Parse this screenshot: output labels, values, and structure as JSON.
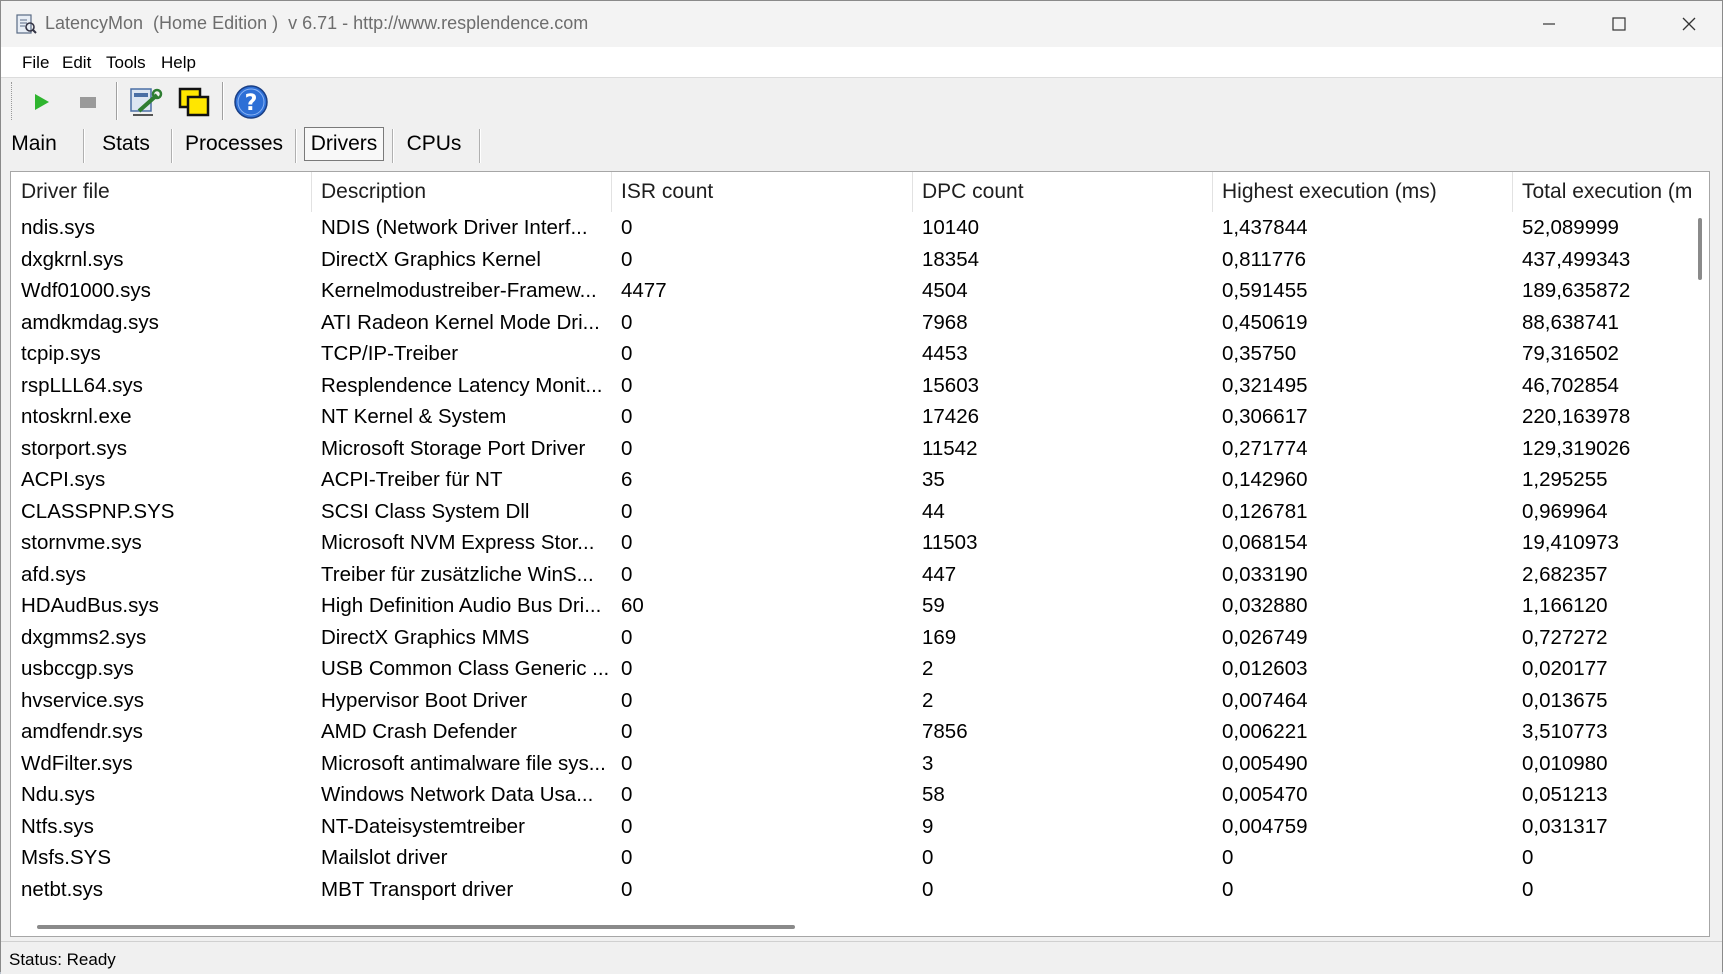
{
  "window": {
    "title": "LatencyMon  (Home Edition )  v 6.71 - http://www.resplendence.com"
  },
  "menu": {
    "file": "File",
    "edit": "Edit",
    "tools": "Tools",
    "help": "Help"
  },
  "toolbar": {
    "icons": [
      "play-icon",
      "stop-icon",
      "wrench-icon",
      "windows-icon",
      "help-icon"
    ]
  },
  "tabs": {
    "main": "Main",
    "stats": "Stats",
    "processes": "Processes",
    "drivers": "Drivers",
    "cpus": "CPUs",
    "active": "Drivers"
  },
  "table": {
    "columns": [
      "Driver file",
      "Description",
      "ISR count",
      "DPC count",
      "Highest execution (ms)",
      "Total execution (m"
    ],
    "rows": [
      [
        "ndis.sys",
        "NDIS (Network Driver Interf...",
        "0",
        "10140",
        "1,437844",
        "52,089999"
      ],
      [
        "dxgkrnl.sys",
        "DirectX Graphics Kernel",
        "0",
        "18354",
        "0,811776",
        "437,499343"
      ],
      [
        "Wdf01000.sys",
        "Kernelmodustreiber-Framew...",
        "4477",
        "4504",
        "0,591455",
        "189,635872"
      ],
      [
        "amdkmdag.sys",
        "ATI Radeon Kernel Mode Dri...",
        "0",
        "7968",
        "0,450619",
        "88,638741"
      ],
      [
        "tcpip.sys",
        "TCP/IP-Treiber",
        "0",
        "4453",
        "0,35750",
        "79,316502"
      ],
      [
        "rspLLL64.sys",
        "Resplendence Latency Monit...",
        "0",
        "15603",
        "0,321495",
        "46,702854"
      ],
      [
        "ntoskrnl.exe",
        "NT Kernel & System",
        "0",
        "17426",
        "0,306617",
        "220,163978"
      ],
      [
        "storport.sys",
        "Microsoft Storage Port Driver",
        "0",
        "11542",
        "0,271774",
        "129,319026"
      ],
      [
        "ACPI.sys",
        "ACPI-Treiber für NT",
        "6",
        "35",
        "0,142960",
        "1,295255"
      ],
      [
        "CLASSPNP.SYS",
        "SCSI Class System Dll",
        "0",
        "44",
        "0,126781",
        "0,969964"
      ],
      [
        "stornvme.sys",
        "Microsoft NVM Express Stor...",
        "0",
        "11503",
        "0,068154",
        "19,410973"
      ],
      [
        "afd.sys",
        "Treiber für zusätzliche WinS...",
        "0",
        "447",
        "0,033190",
        "2,682357"
      ],
      [
        "HDAudBus.sys",
        "High Definition Audio Bus Dri...",
        "60",
        "59",
        "0,032880",
        "1,166120"
      ],
      [
        "dxgmms2.sys",
        "DirectX Graphics MMS",
        "0",
        "169",
        "0,026749",
        "0,727272"
      ],
      [
        "usbccgp.sys",
        "USB Common Class Generic ...",
        "0",
        "2",
        "0,012603",
        "0,020177"
      ],
      [
        "hvservice.sys",
        "Hypervisor Boot Driver",
        "0",
        "2",
        "0,007464",
        "0,013675"
      ],
      [
        "amdfendr.sys",
        "AMD Crash Defender",
        "0",
        "7856",
        "0,006221",
        "3,510773"
      ],
      [
        "WdFilter.sys",
        "Microsoft antimalware file sys...",
        "0",
        "3",
        "0,005490",
        "0,010980"
      ],
      [
        "Ndu.sys",
        "Windows Network Data Usa...",
        "0",
        "58",
        "0,005470",
        "0,051213"
      ],
      [
        "Ntfs.sys",
        "NT-Dateisystemtreiber",
        "0",
        "9",
        "0,004759",
        "0,031317"
      ],
      [
        "Msfs.SYS",
        "Mailslot driver",
        "0",
        "0",
        "0",
        "0"
      ],
      [
        "netbt.sys",
        "MBT Transport driver",
        "0",
        "0",
        "0",
        "0"
      ]
    ]
  },
  "status": {
    "text": "Status: Ready"
  },
  "colors": {
    "play": "#2fb52f",
    "stop": "#9a9a9a",
    "help": "#2d6fd6"
  }
}
